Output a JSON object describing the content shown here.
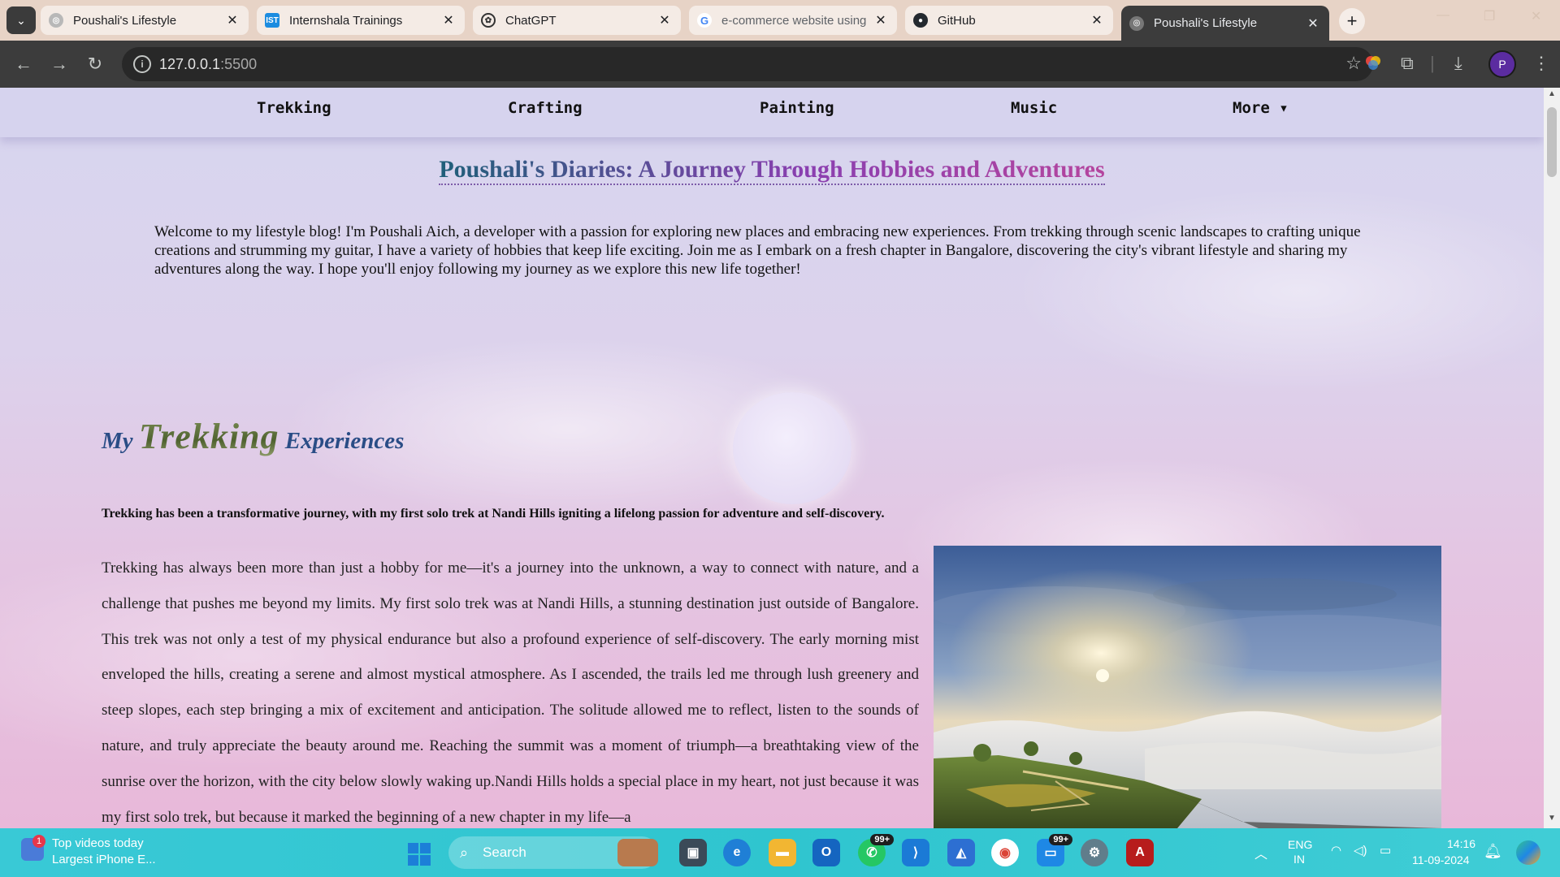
{
  "tabs": [
    {
      "title": "Poushali's Lifestyle",
      "favicon": "globe-icon",
      "active": false
    },
    {
      "title": "Internshala Trainings",
      "favicon": "internshala-icon",
      "active": false
    },
    {
      "title": "ChatGPT",
      "favicon": "chatgpt-icon",
      "active": false
    },
    {
      "title": "e-commerce website using",
      "favicon": "google-icon",
      "active": false
    },
    {
      "title": "GitHub",
      "favicon": "github-icon",
      "active": false
    },
    {
      "title": "Poushali's Lifestyle",
      "favicon": "globe-icon",
      "active": true
    }
  ],
  "address": {
    "host": "127.0.0.1",
    "port": ":5500"
  },
  "site_nav": [
    "Trekking",
    "Crafting",
    "Painting",
    "Music",
    "More ▾"
  ],
  "page": {
    "title": "Poushali's Diaries: A Journey Through Hobbies and Adventures",
    "intro": "Welcome to my lifestyle blog! I'm Poushali Aich, a developer with a passion for exploring new places and embracing new experiences. From trekking through scenic landscapes to crafting unique creations and strumming my guitar, I have a variety of hobbies that keep life exciting. Join me as I embark on a fresh chapter in Bangalore, discovering the city's vibrant lifestyle and sharing my adventures along the way. I hope you'll enjoy following my journey as we explore this new life together!",
    "section": {
      "heading_pre": "My",
      "heading_main": "Trekking",
      "heading_post": "Experiences",
      "lead": "Trekking has been a transformative journey, with my first solo trek at Nandi Hills igniting a lifelong passion for adventure and self-discovery.",
      "body": "Trekking has always been more than just a hobby for me—it's a journey into the unknown, a way to connect with nature, and a challenge that pushes me beyond my limits. My first solo trek was at Nandi Hills, a stunning destination just outside of Bangalore. This trek was not only a test of my physical endurance but also a profound experience of self-discovery. The early morning mist enveloped the hills, creating a serene and almost mystical atmosphere. As I ascended, the trails led me through lush greenery and steep slopes, each step bringing a mix of excitement and anticipation. The solitude allowed me to reflect, listen to the sounds of nature, and truly appreciate the beauty around me. Reaching the summit was a moment of triumph—a breathtaking view of the sunrise over the horizon, with the city below slowly waking up.Nandi Hills holds a special place in my heart, not just because it was my first solo trek, but because it marked the beginning of a new chapter in my life—a"
    }
  },
  "taskbar": {
    "news_badge": "1",
    "news_title": "Top videos today",
    "news_subtitle": "Largest iPhone E...",
    "search_placeholder": "Search",
    "whatsapp_badge": "99+",
    "teams_badge": "99+",
    "lang_1": "ENG",
    "lang_2": "IN",
    "time": "14:16",
    "date": "11-09-2024"
  },
  "colors": {
    "accent_nav": "#d6d2ee",
    "heading": "#2a4d86",
    "taskbar": "#2fc5cf",
    "chrome": "#3c3c3c"
  }
}
